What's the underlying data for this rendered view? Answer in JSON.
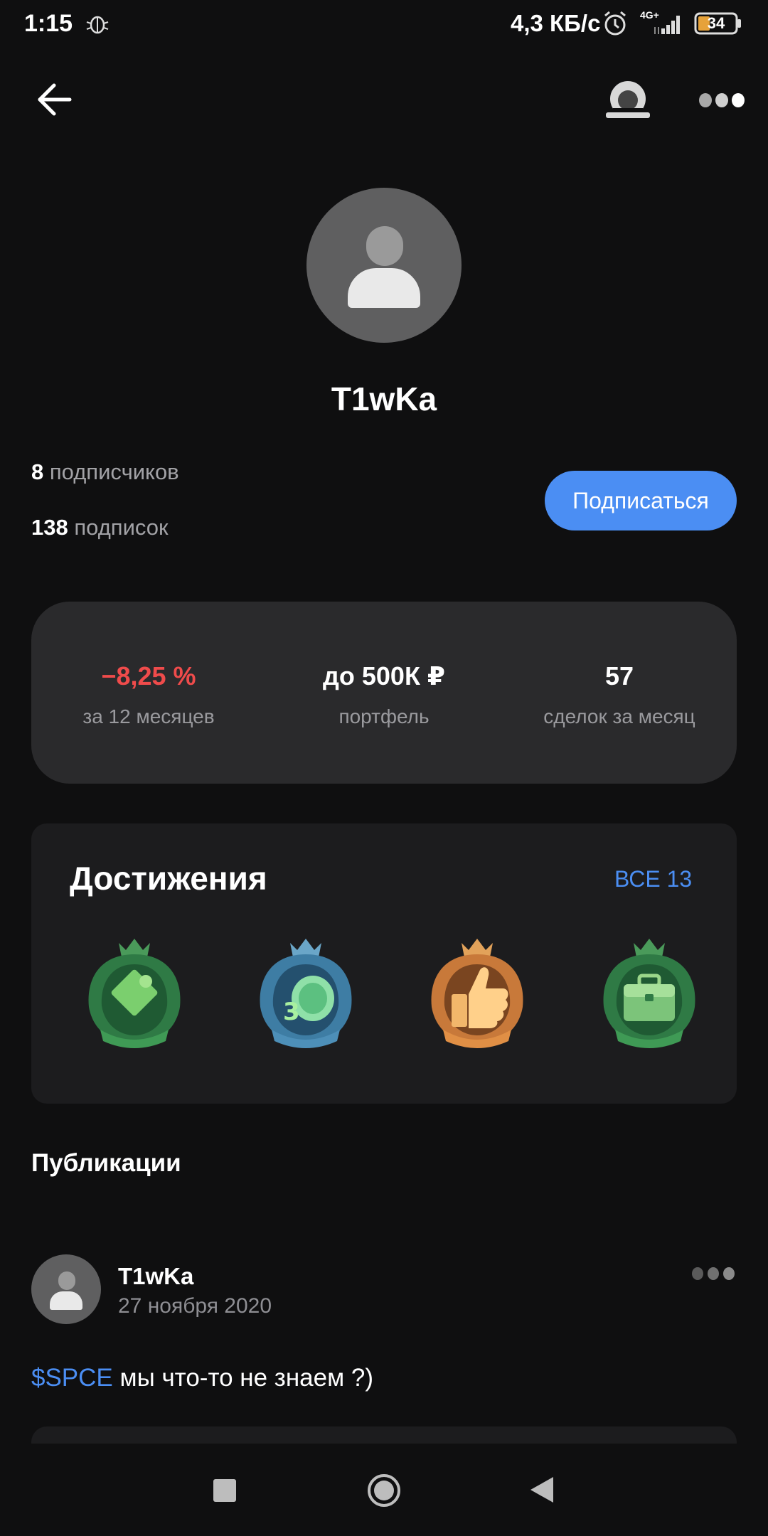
{
  "status_bar": {
    "time": "1:15",
    "network_speed": "4,3 КБ/с",
    "network_type": "4G+",
    "battery": "34"
  },
  "header": {
    "back_icon": "arrow-left-icon",
    "record_icon": "record-icon",
    "more_icon": "more-dots-icon"
  },
  "profile": {
    "username": "T1wKa",
    "followers_count": "8",
    "followers_label": "подписчиков",
    "following_count": "138",
    "following_label": "подписок",
    "subscribe_label": "Подписаться"
  },
  "stats": [
    {
      "value": "−8,25 %",
      "label": "за 12 месяцев"
    },
    {
      "value": "до 500К ₽",
      "label": "портфель"
    },
    {
      "value": "57",
      "label": "сделок за месяц"
    }
  ],
  "achievements": {
    "title": "Достижения",
    "all_label": "ВСЕ 13",
    "badges": [
      "puzzle-badge-icon",
      "coins-badge-icon",
      "thumbs-up-badge-icon",
      "briefcase-badge-icon"
    ]
  },
  "publications": {
    "title": "Публикации",
    "post": {
      "author": "T1wKa",
      "date": "27 ноября 2020",
      "ticker": "$SPCE",
      "text": " мы что-то не знаем ?)"
    }
  },
  "colors": {
    "background": "#0f0f10",
    "accent": "#4b8ef3",
    "negative": "#ef4b4b",
    "card": "#2a2a2c"
  }
}
